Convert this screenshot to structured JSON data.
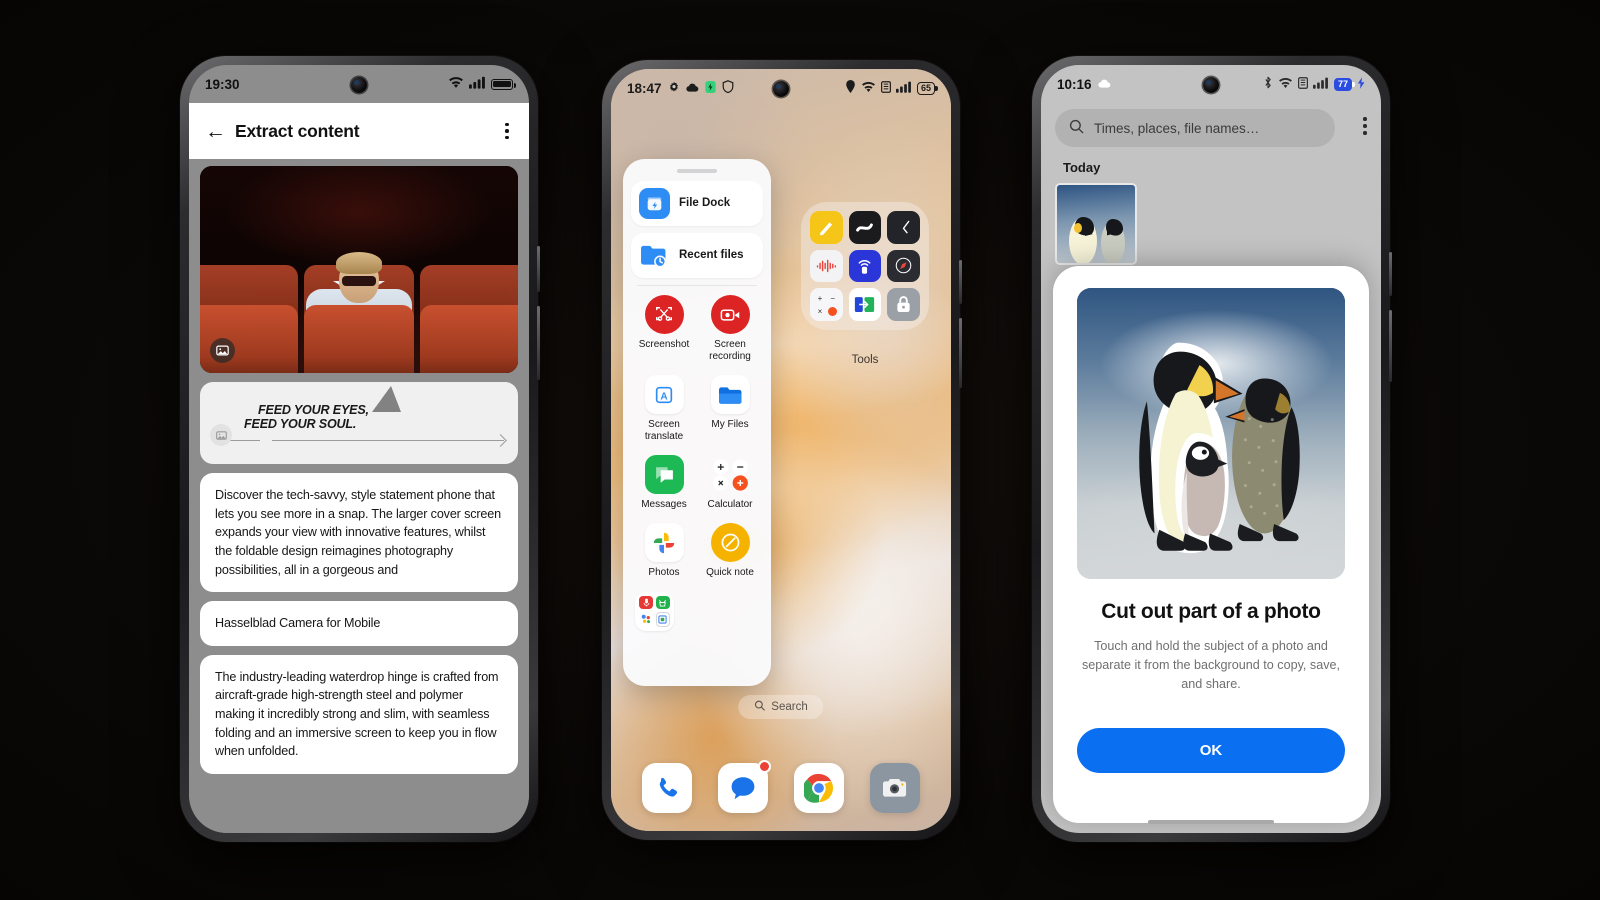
{
  "scene": {
    "background": "#0a0806",
    "device_count": 3
  },
  "phone1": {
    "status": {
      "time": "19:30",
      "wifi": "wifi-icon",
      "signal": "signal-icon",
      "battery": "battery-full-icon"
    },
    "appbar": {
      "back": "←",
      "title": "Extract content",
      "overflow": "more-vert-icon"
    },
    "photo": {
      "alt": "person-in-cinema-photo",
      "badge": "image-badge-icon"
    },
    "quote_card": {
      "line1": "FEED YOUR EYES,",
      "line2": "FEED YOUR SOUL.",
      "badge": "image-badge-icon"
    },
    "cards": [
      {
        "text": "Discover the tech-savvy, style statement phone that lets you see more in a snap. The larger cover screen expands your view with innovative features, whilst the foldable design reimagines photography possibilities, all in a gorgeous and"
      },
      {
        "text": "Hasselblad Camera for Mobile"
      },
      {
        "text": "The industry-leading waterdrop hinge is crafted from aircraft-grade high-strength steel and polymer making it incredibly strong and slim, with seamless folding and an immersive screen to keep you in flow when unfolded."
      }
    ]
  },
  "phone2": {
    "status": {
      "time": "18:47",
      "left_icons": [
        "gear-icon",
        "cloud-icon",
        "green-battery-saver-icon",
        "shield-icon"
      ],
      "right_icons": [
        "location-icon",
        "wifi-icon",
        "sim-icon",
        "signal-icon"
      ],
      "battery_percent": "65"
    },
    "panel": {
      "handle": "drag-handle",
      "rows": [
        {
          "label": "File Dock",
          "icon": "file-dock-icon",
          "color": "#2e8df5"
        },
        {
          "label": "Recent files",
          "icon": "recent-files-icon",
          "color": "#2e8df5"
        }
      ],
      "apps": [
        {
          "label": "Screenshot",
          "icon": "screenshot-icon",
          "color": "#dd2424",
          "shape": "circle"
        },
        {
          "label": "Screen recording",
          "icon": "screen-recording-icon",
          "color": "#dd2424",
          "shape": "circle"
        },
        {
          "label": "Screen translate",
          "icon": "screen-translate-icon",
          "color": "#ffffff",
          "shape": "rounded"
        },
        {
          "label": "My Files",
          "icon": "my-files-folder-icon",
          "color": "#ffffff",
          "shape": "rounded"
        },
        {
          "label": "Messages",
          "icon": "messages-icon",
          "color": "#1db954",
          "shape": "rounded"
        },
        {
          "label": "Calculator",
          "icon": "calculator-icon",
          "color": "#ffffff",
          "shape": "rounded"
        },
        {
          "label": "Photos",
          "icon": "google-photos-icon",
          "color": "#ffffff",
          "shape": "rounded"
        },
        {
          "label": "Quick note",
          "icon": "quick-note-icon",
          "color": "#f5b300",
          "shape": "circle"
        }
      ],
      "folder_tile": "mini-app-folder-icon"
    },
    "tools_folder": {
      "label": "Tools",
      "tiles": [
        "notes-icon",
        "screen-mirror-icon",
        "clock-icon",
        "recorder-icon",
        "remote-control-icon",
        "compass-icon",
        "calculator-icon",
        "exit-app-icon",
        "lock-icon"
      ]
    },
    "search_pill": {
      "label": "Search",
      "icon": "search-icon"
    },
    "dock": [
      {
        "name": "phone-app",
        "icon": "phone-icon"
      },
      {
        "name": "messages-app",
        "icon": "messages-icon",
        "badge": true
      },
      {
        "name": "chrome-app",
        "icon": "chrome-icon"
      },
      {
        "name": "camera-app",
        "icon": "camera-icon"
      }
    ]
  },
  "phone3": {
    "status": {
      "time": "10:16",
      "left_icons": [
        "cloud-icon"
      ],
      "right_icons": [
        "bluetooth-icon",
        "wifi-icon",
        "sim-icon",
        "signal-icon"
      ],
      "battery_percent": "77",
      "charging": "charging-bolt-icon"
    },
    "search": {
      "placeholder": "Times, places, file names…",
      "icon": "search-icon"
    },
    "overflow": "more-vert-icon",
    "section_header": "Today",
    "thumbnail": "penguins-photo-thumbnail",
    "dialog": {
      "hero_image": "penguins-cutout-photo",
      "title": "Cut out part of a photo",
      "body": "Touch and hold the subject of a photo and separate it from the background to copy, save, and share.",
      "primary_button": "OK",
      "primary_color": "#0b6ff2"
    },
    "home_indicator": "home-indicator-bar"
  }
}
